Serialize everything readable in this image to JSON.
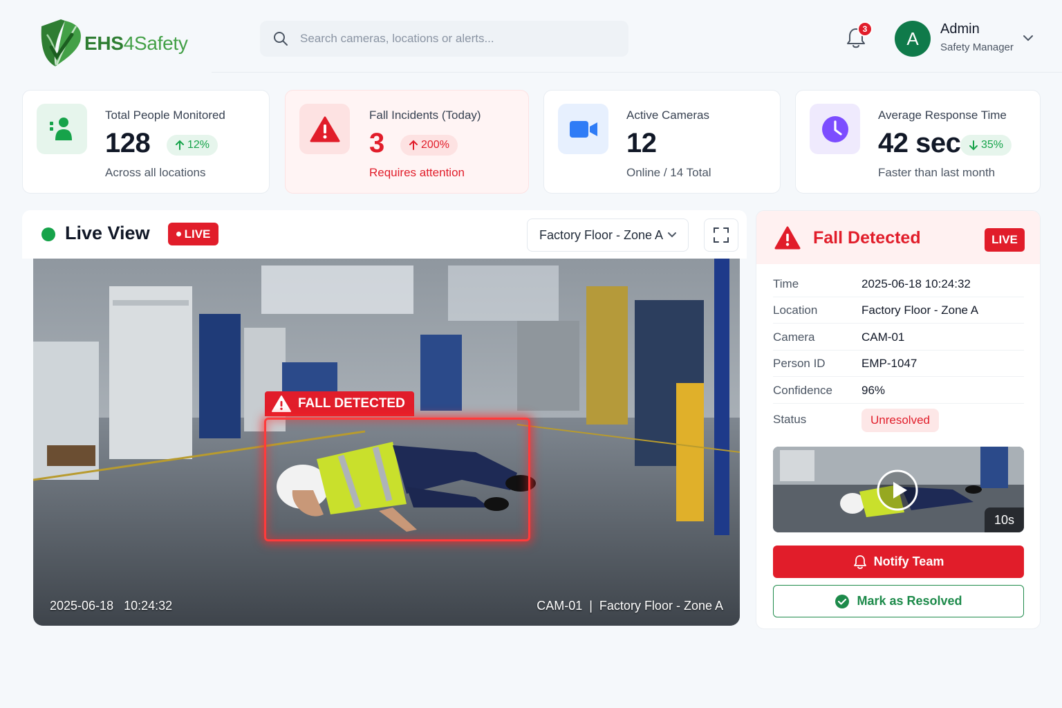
{
  "brand": {
    "name_part1": "EHS",
    "name_part2": "4Safety"
  },
  "search": {
    "placeholder": "Search cameras, locations or alerts..."
  },
  "notifications": {
    "count": "3"
  },
  "user": {
    "initial": "A",
    "name": "Admin",
    "role": "Safety Manager"
  },
  "stats": [
    {
      "label": "Total People Monitored",
      "value": "128",
      "change": "12%",
      "trend": "up",
      "sub": "Across all locations",
      "icon": "person-icon",
      "color": "#16a34a"
    },
    {
      "label": "Fall Incidents (Today)",
      "value": "3",
      "change": "200%",
      "trend": "up",
      "sub": "Requires attention",
      "icon": "warning-icon",
      "color": "#e11d2a"
    },
    {
      "label": "Active Cameras",
      "value": "12",
      "sub": "Online / 14 Total",
      "icon": "camera-icon",
      "color": "#2f7cf6"
    },
    {
      "label": "Average Response Time",
      "value": "42 sec",
      "change": "35%",
      "trend": "down",
      "sub": "Faster than last month",
      "icon": "clock-icon",
      "color": "#7c4dff"
    }
  ],
  "live_view": {
    "title": "Live View",
    "badge": "LIVE",
    "zone": "Factory Floor - Zone A",
    "detection_label": "FALL DETECTED",
    "timestamp": "2025-06-18   10:24:32",
    "camera_caption": "CAM-01  |  Factory Floor - Zone A"
  },
  "alert": {
    "title": "Fall Detected",
    "badge": "LIVE",
    "details": [
      {
        "key": "Time",
        "value": "2025-06-18 10:24:32"
      },
      {
        "key": "Location",
        "value": "Factory Floor - Zone A"
      },
      {
        "key": "Camera",
        "value": "CAM-01"
      },
      {
        "key": "Person ID",
        "value": "EMP-1047"
      },
      {
        "key": "Confidence",
        "value": "96%"
      }
    ],
    "status_label": "Status",
    "status_value": "Unresolved",
    "clip_duration": "10s",
    "notify_label": "Notify Team",
    "resolve_label": "Mark as Resolved"
  },
  "colors": {
    "brand_green": "#2e7d32",
    "alert_red": "#e11d2a",
    "accent_blue": "#2f7cf6",
    "accent_purple": "#7c4dff"
  }
}
